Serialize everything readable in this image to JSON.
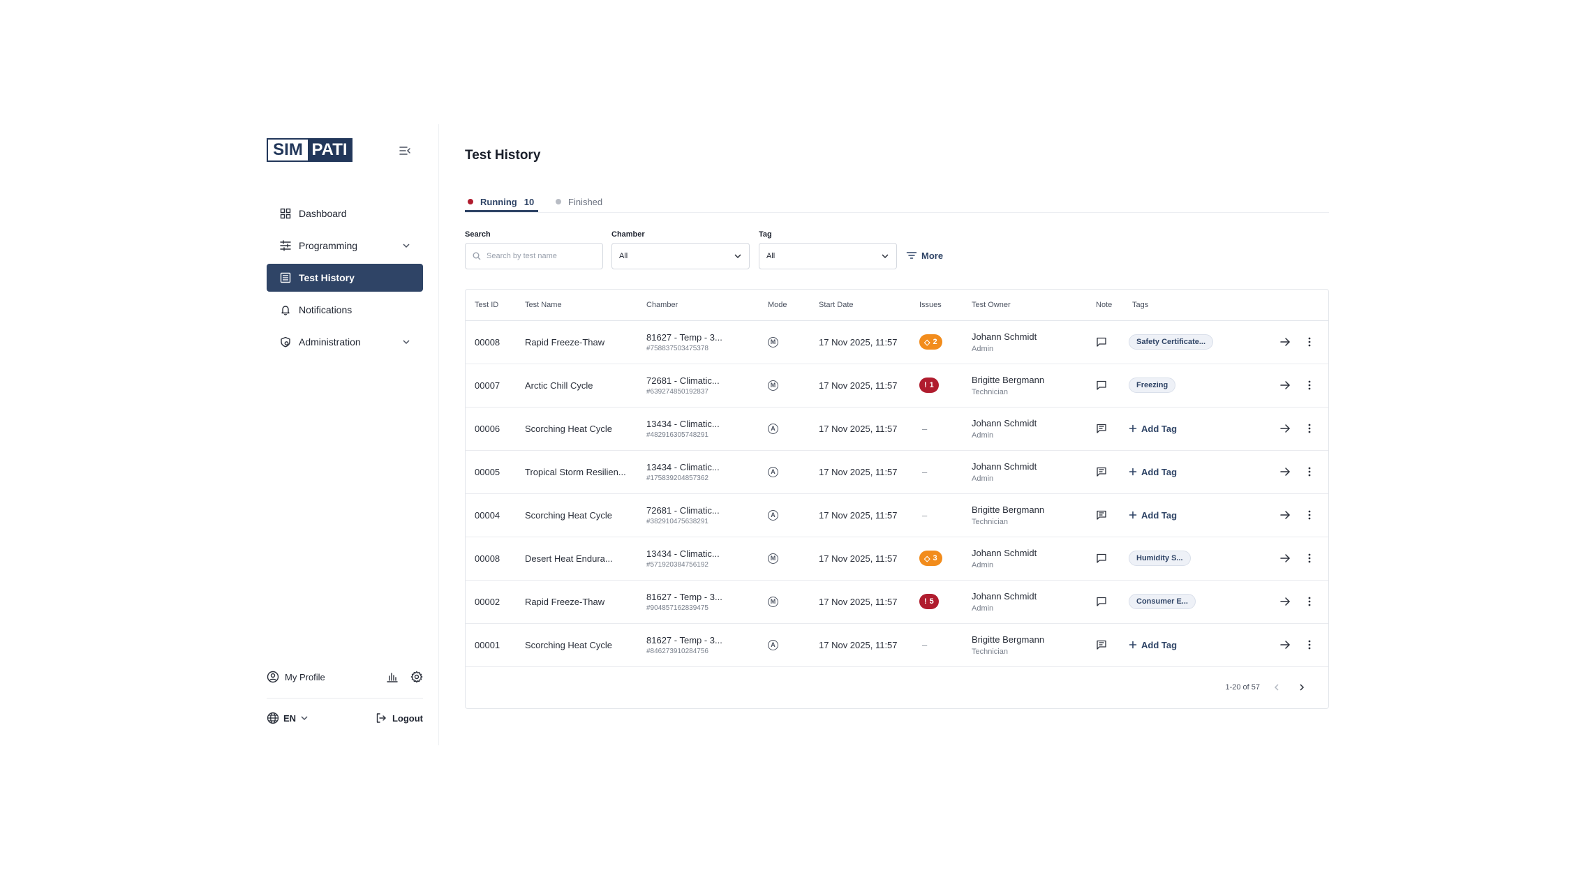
{
  "sidebar": {
    "logo_left": "SIM",
    "logo_right": "PATI",
    "items": [
      {
        "label": "Dashboard",
        "icon": "dashboard-icon"
      },
      {
        "label": "Programming",
        "icon": "sliders-icon"
      },
      {
        "label": "Test History",
        "icon": "list-icon"
      },
      {
        "label": "Notifications",
        "icon": "bell-icon"
      },
      {
        "label": "Administration",
        "icon": "shield-icon"
      }
    ],
    "profile_label": "My Profile",
    "language": "EN",
    "logout_label": "Logout"
  },
  "page": {
    "title": "Test History"
  },
  "tabs": {
    "running_label": "Running",
    "running_count": "10",
    "finished_label": "Finished"
  },
  "filters": {
    "search_label": "Search",
    "search_placeholder": "Search by test name",
    "chamber_label": "Chamber",
    "chamber_value": "All",
    "tag_label": "Tag",
    "tag_value": "All",
    "more_label": "More"
  },
  "table": {
    "headers": {
      "id": "Test ID",
      "name": "Test Name",
      "chamber": "Chamber",
      "mode": "Mode",
      "start": "Start Date",
      "issues": "Issues",
      "owner": "Test Owner",
      "note": "Note",
      "tags": "Tags"
    },
    "add_tag_label": "Add Tag",
    "rows": [
      {
        "id": "00008",
        "name": "Rapid Freeze-Thaw",
        "chamber": "81627 - Temp - 3...",
        "chamber_id": "#758837503475378",
        "mode": "M",
        "start": "17 Nov 2025, 11:57",
        "issue_type": "warn",
        "issues": "2",
        "owner": "Johann Schmidt",
        "role": "Admin",
        "note_filled": false,
        "tag": "Safety Certificate..."
      },
      {
        "id": "00007",
        "name": "Arctic Chill Cycle",
        "chamber": "72681 - Climatic...",
        "chamber_id": "#639274850192837",
        "mode": "M",
        "start": "17 Nov 2025, 11:57",
        "issue_type": "crit",
        "issues": "1",
        "owner": "Brigitte Bergmann",
        "role": "Technician",
        "note_filled": false,
        "tag": "Freezing"
      },
      {
        "id": "00006",
        "name": "Scorching Heat Cycle",
        "chamber": "13434 - Climatic...",
        "chamber_id": "#482916305748291",
        "mode": "A",
        "start": "17 Nov 2025, 11:57",
        "issue_type": "none",
        "issues": "–",
        "owner": "Johann Schmidt",
        "role": "Admin",
        "note_filled": true,
        "tag": ""
      },
      {
        "id": "00005",
        "name": "Tropical Storm Resilien...",
        "chamber": "13434 - Climatic...",
        "chamber_id": "#175839204857362",
        "mode": "A",
        "start": "17 Nov 2025, 11:57",
        "issue_type": "none",
        "issues": "–",
        "owner": "Johann Schmidt",
        "role": "Admin",
        "note_filled": true,
        "tag": ""
      },
      {
        "id": "00004",
        "name": "Scorching Heat Cycle",
        "chamber": "72681 - Climatic...",
        "chamber_id": "#382910475638291",
        "mode": "A",
        "start": "17 Nov 2025, 11:57",
        "issue_type": "none",
        "issues": "–",
        "owner": "Brigitte Bergmann",
        "role": "Technician",
        "note_filled": true,
        "tag": ""
      },
      {
        "id": "00008",
        "name": "Desert Heat Endura...",
        "chamber": "13434 - Climatic...",
        "chamber_id": "#571920384756192",
        "mode": "M",
        "start": "17 Nov 2025, 11:57",
        "issue_type": "warn",
        "issues": "3",
        "owner": "Johann Schmidt",
        "role": "Admin",
        "note_filled": false,
        "tag": "Humidity S..."
      },
      {
        "id": "00002",
        "name": "Rapid Freeze-Thaw",
        "chamber": "81627 - Temp - 3...",
        "chamber_id": "#904857162839475",
        "mode": "M",
        "start": "17 Nov 2025, 11:57",
        "issue_type": "crit",
        "issues": "5",
        "owner": "Johann Schmidt",
        "role": "Admin",
        "note_filled": false,
        "tag": "Consumer E..."
      },
      {
        "id": "00001",
        "name": "Scorching Heat Cycle",
        "chamber": "81627 - Temp - 3...",
        "chamber_id": "#846273910284756",
        "mode": "A",
        "start": "17 Nov 2025, 11:57",
        "issue_type": "none",
        "issues": "–",
        "owner": "Brigitte Bergmann",
        "role": "Technician",
        "note_filled": true,
        "tag": ""
      }
    ]
  },
  "pagination": {
    "range": "1-20 of 57"
  },
  "colors": {
    "brand": "#22375a",
    "accent": "#2f4466",
    "warning": "#f28c1c",
    "critical": "#b01c2e"
  }
}
